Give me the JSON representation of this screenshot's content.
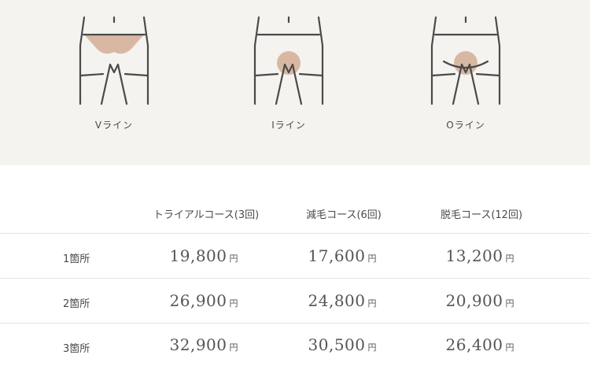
{
  "figures": [
    {
      "label": "Vライン",
      "icon": "v-line-body-icon"
    },
    {
      "label": "Iライン",
      "icon": "i-line-body-icon"
    },
    {
      "label": "Oライン",
      "icon": "o-line-body-icon"
    }
  ],
  "colors": {
    "highlight": "#d9b8a3",
    "stroke": "#4a4a4a",
    "panel": "#f4f3f0"
  },
  "table": {
    "columns": [
      "トライアルコース(3回)",
      "減毛コース(6回)",
      "脱毛コース(12回)"
    ],
    "unit": "円",
    "rows": [
      {
        "label": "1箇所",
        "prices": [
          "19,800",
          "17,600",
          "13,200"
        ]
      },
      {
        "label": "2箇所",
        "prices": [
          "26,900",
          "24,800",
          "20,900"
        ]
      },
      {
        "label": "3箇所",
        "prices": [
          "32,900",
          "30,500",
          "26,400"
        ]
      }
    ]
  }
}
